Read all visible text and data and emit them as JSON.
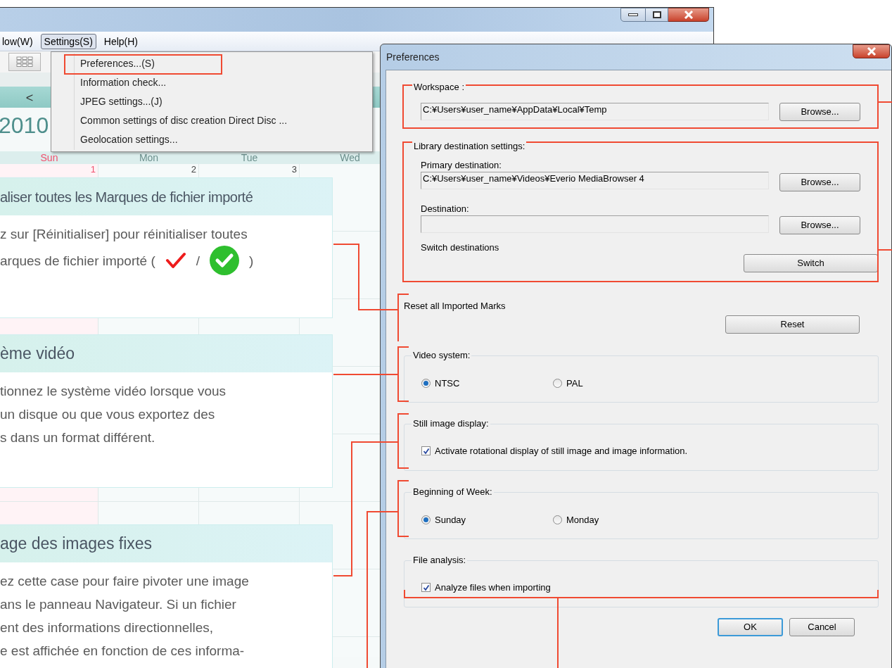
{
  "menu_bar": [
    {
      "label": "low(W)",
      "selected": false
    },
    {
      "label": "Settings(S)",
      "selected": true
    },
    {
      "label": "Help(H)",
      "selected": false
    }
  ],
  "menu": {
    "items": [
      "Preferences...(S)",
      "Information check...",
      "JPEG settings...(J)",
      "Common settings of disc creation  Direct Disc ...",
      "Geolocation settings..."
    ]
  },
  "calendar": {
    "prev": "<",
    "year": "2010",
    "days": [
      {
        "label": "Sun",
        "weekend": true
      },
      {
        "label": "Mon",
        "weekend": false
      },
      {
        "label": "Tue",
        "weekend": false
      },
      {
        "label": "Wed",
        "weekend": false
      }
    ],
    "dates": [
      "1",
      "2",
      "3"
    ]
  },
  "notes": [
    {
      "heading": "aliser toutes les Marques de fichier importé",
      "lines": [
        "z sur [Réinitialiser] pour réinitialiser toutes"
      ],
      "marks_line": {
        "before": "arques de fichier importé (",
        "separator": "/",
        "after": ")"
      }
    },
    {
      "heading": "ème vidéo",
      "lines": [
        "tionnez le système vidéo lorsque vous",
        "un disque ou que vous exportez des",
        "s dans un format différent."
      ]
    },
    {
      "heading": "age des images fixes",
      "lines": [
        "ez cette case pour faire pivoter une image",
        "ans le panneau Navigateur. Si un fichier",
        "ent des informations directionnelles,",
        "e est affichée en fonction de ces informa-"
      ]
    }
  ],
  "dialog": {
    "title": "Preferences",
    "workspace": {
      "label": "Workspace :",
      "path": "C:¥Users¥user_name¥AppData¥Local¥Temp",
      "button": "Browse..."
    },
    "library": {
      "label": "Library destination settings:",
      "primary_label": "Primary destination:",
      "primary_path": "C:¥Users¥user_name¥Videos¥Everio MediaBrowser 4",
      "primary_button": "Browse...",
      "destination_label": "Destination:",
      "destination_button": "Browse...",
      "switch_label": "Switch destinations",
      "switch_button": "Switch"
    },
    "reset": {
      "label": "Reset all Imported Marks",
      "button": "Reset"
    },
    "video_system": {
      "label": "Video system:",
      "options": [
        {
          "label": "NTSC",
          "selected": true
        },
        {
          "label": "PAL",
          "selected": false
        }
      ]
    },
    "still_image": {
      "label": "Still image display:",
      "checkbox": {
        "label": "Activate rotational display of still image and image information.",
        "checked": true
      }
    },
    "week": {
      "label": "Beginning of Week:",
      "options": [
        {
          "label": "Sunday",
          "selected": true
        },
        {
          "label": "Monday",
          "selected": false
        }
      ]
    },
    "file_analysis": {
      "label": "File analysis:",
      "checkbox": {
        "label": "Analyze files when importing",
        "checked": true
      }
    },
    "buttons": [
      {
        "label": "OK",
        "default": true
      },
      {
        "label": "Cancel",
        "default": false
      }
    ]
  }
}
